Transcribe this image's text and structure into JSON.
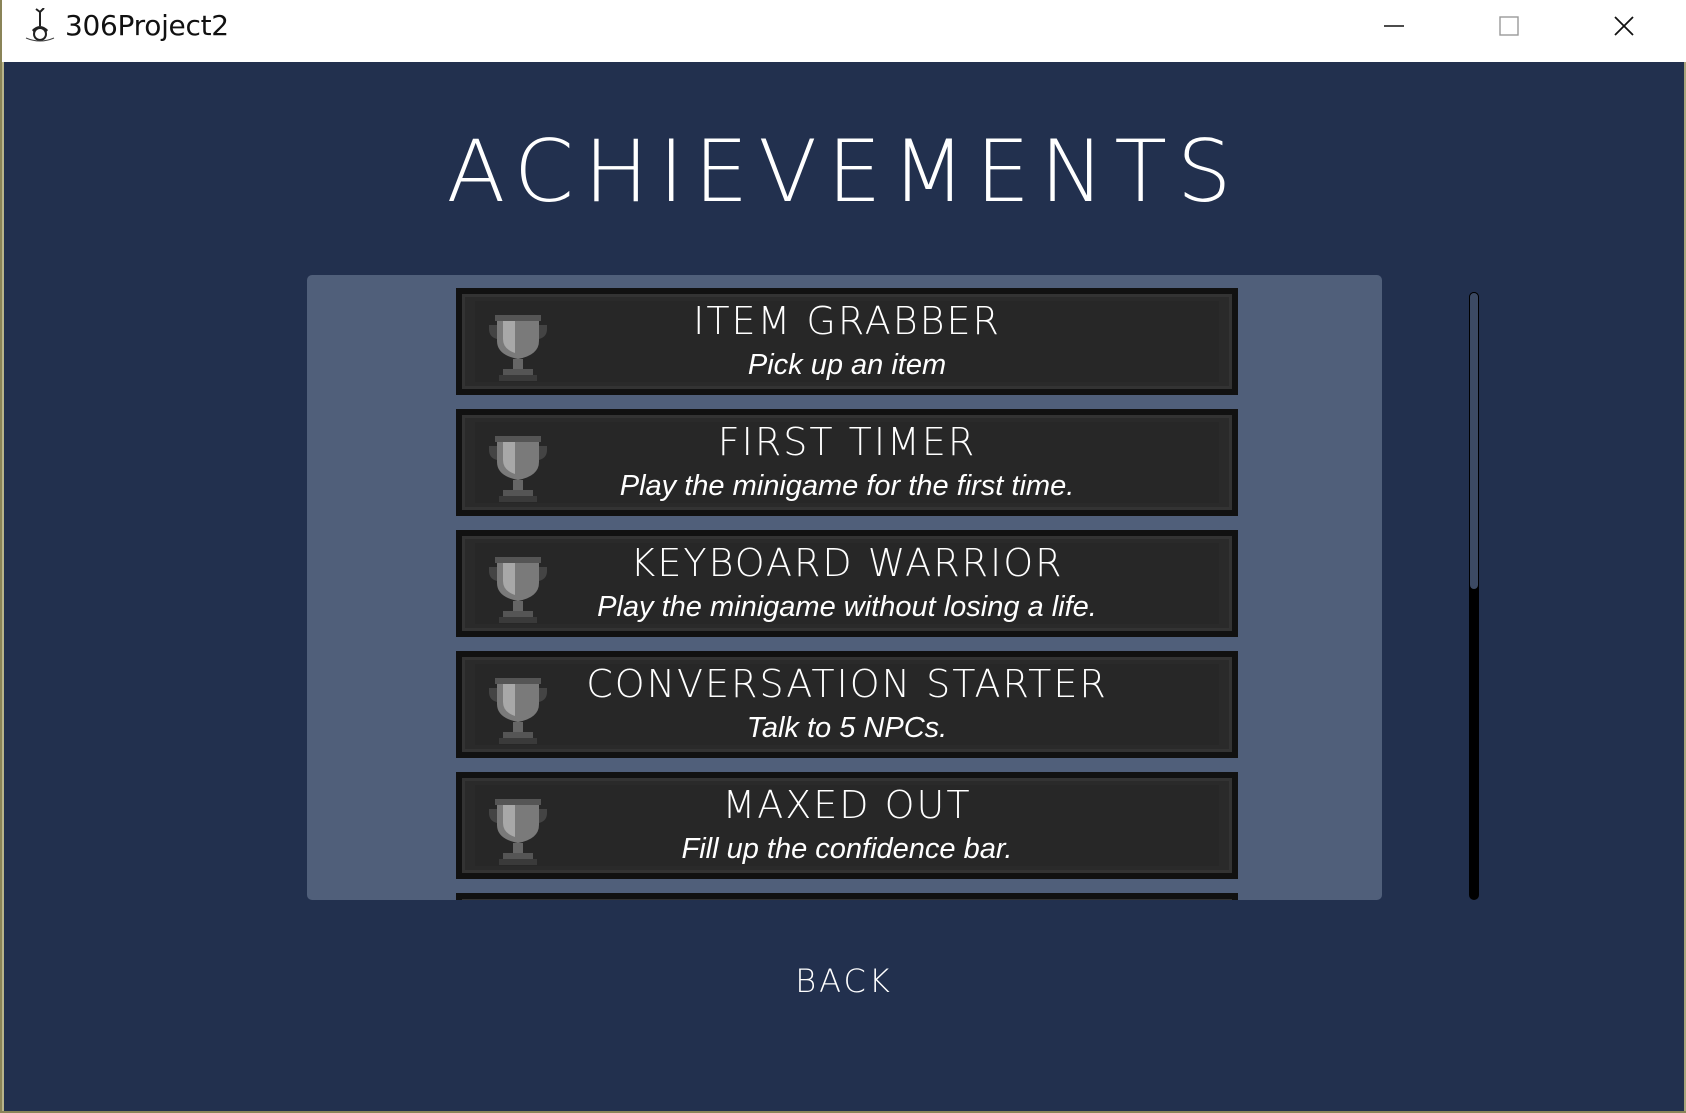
{
  "window": {
    "title": "306Project2",
    "controls": {
      "minimize": "minimize-icon",
      "maximize": "maximize-icon",
      "close": "close-icon"
    }
  },
  "screen": {
    "heading": "ACHIEVEMENTS",
    "back_label": "BACK"
  },
  "achievements": [
    {
      "title": "ITEM GRABBER",
      "description": "Pick up an item",
      "icon": "trophy-icon"
    },
    {
      "title": "FIRST TIMER",
      "description": "Play the minigame for the first time.",
      "icon": "trophy-icon"
    },
    {
      "title": "KEYBOARD WARRIOR",
      "description": "Play the minigame without losing a life.",
      "icon": "trophy-icon"
    },
    {
      "title": "CONVERSATION STARTER",
      "description": "Talk to 5 NPCs.",
      "icon": "trophy-icon"
    },
    {
      "title": "MAXED OUT",
      "description": "Fill up the confidence bar.",
      "icon": "trophy-icon"
    }
  ],
  "scrollbar": {
    "position_fraction": 0.0,
    "visible_fraction": 0.49
  },
  "colors": {
    "background": "#22304e",
    "panel": "#505f7a",
    "card": "#272727",
    "text": "#ffffff"
  }
}
